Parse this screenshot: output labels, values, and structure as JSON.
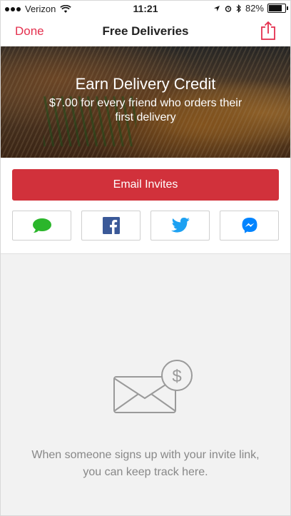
{
  "status_bar": {
    "carrier": "Verizon",
    "time": "11:21",
    "battery": "82%",
    "battery_level": 0.82
  },
  "nav": {
    "done_label": "Done",
    "title": "Free Deliveries",
    "share_icon": "share-icon"
  },
  "hero": {
    "title": "Earn Delivery Credit",
    "subtitle": "$7.00 for every friend who orders their first delivery"
  },
  "invite": {
    "email_label": "Email Invites",
    "share_options": [
      "message-icon",
      "facebook-icon",
      "twitter-icon",
      "messenger-icon"
    ]
  },
  "empty_state": {
    "icon": "envelope-dollar-icon",
    "message": "When someone signs up with your invite link, you can keep track here."
  },
  "colors": {
    "accent": "#e4304e",
    "button": "#d1313b",
    "facebook": "#3b5998",
    "twitter": "#1da1f2",
    "messenger": "#0084ff",
    "message": "#2bb62b"
  }
}
